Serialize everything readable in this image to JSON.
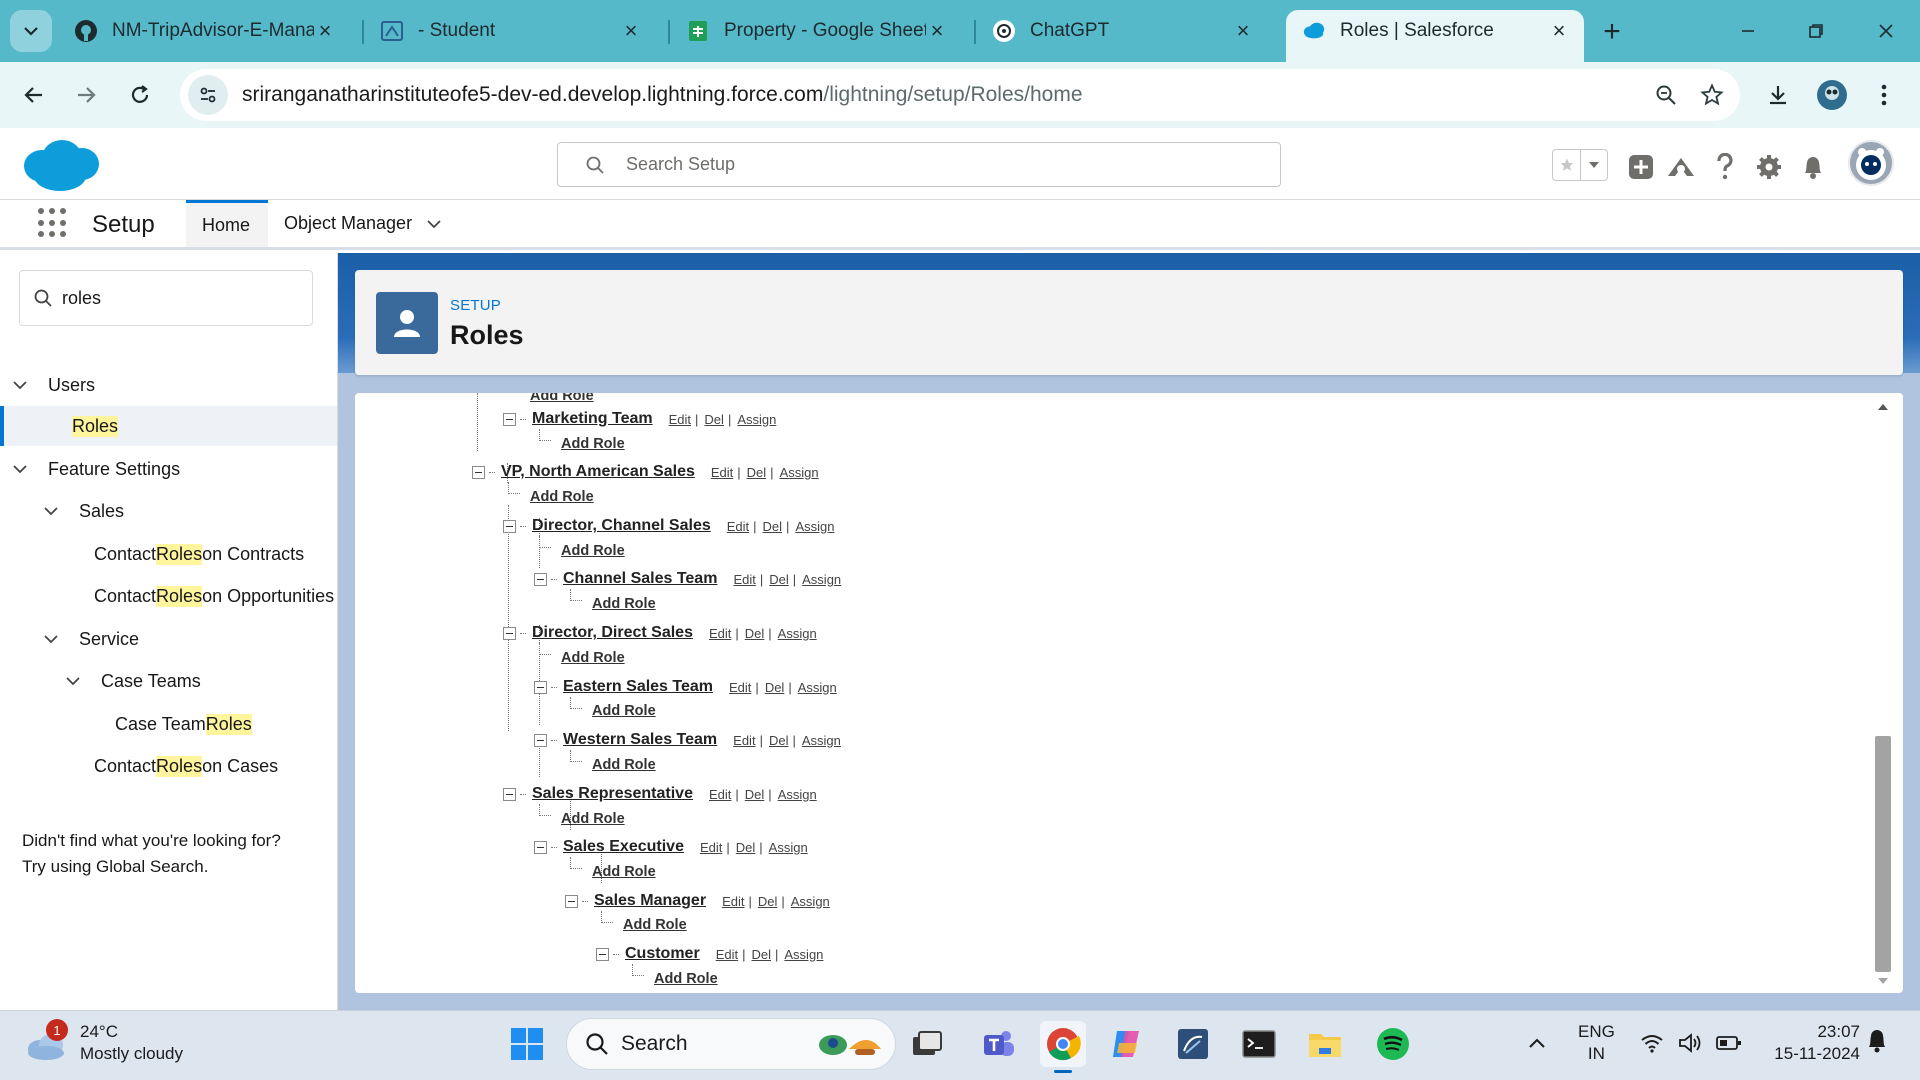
{
  "browser": {
    "tabs": [
      {
        "title": "NM-TripAdvisor-E-Manag",
        "icon": "github-icon"
      },
      {
        "title": "- Student",
        "icon": "student-icon"
      },
      {
        "title": "Property - Google Sheets",
        "icon": "google-sheets-icon"
      },
      {
        "title": "ChatGPT",
        "icon": "chatgpt-icon"
      },
      {
        "title": "Roles | Salesforce",
        "icon": "salesforce-icon",
        "active": true
      }
    ],
    "url_host": "sriranganatharinstituteofe5-dev-ed.develop.lightning.force.com",
    "url_path": "/lightning/setup/Roles/home"
  },
  "header": {
    "search_placeholder": "Search Setup"
  },
  "context_nav": {
    "app_name": "Setup",
    "tabs": [
      {
        "label": "Home",
        "active": true
      },
      {
        "label": "Object Manager"
      }
    ]
  },
  "sidebar": {
    "quick_find_value": "roles",
    "items": [
      {
        "pre": "Users",
        "hl": "",
        "post": ""
      },
      {
        "pre": "",
        "hl": "Roles",
        "post": ""
      },
      {
        "pre": "Feature Settings",
        "hl": "",
        "post": ""
      },
      {
        "pre": "Sales",
        "hl": "",
        "post": ""
      },
      {
        "pre": "Contact ",
        "hl": "Roles",
        "post": " on Contracts"
      },
      {
        "pre": "Contact ",
        "hl": "Roles",
        "post": " on Opportunities"
      },
      {
        "pre": "Service",
        "hl": "",
        "post": ""
      },
      {
        "pre": "Case Teams",
        "hl": "",
        "post": ""
      },
      {
        "pre": "Case Team ",
        "hl": "Roles",
        "post": ""
      },
      {
        "pre": "Contact ",
        "hl": "Roles",
        "post": " on Cases"
      }
    ],
    "not_found_line1": "Didn't find what you're looking for?",
    "not_found_line2": "Try using Global Search."
  },
  "page": {
    "eyebrow": "SETUP",
    "title": "Roles"
  },
  "actions": {
    "edit": "Edit",
    "del": "Del",
    "assign": "Assign",
    "add_role": "Add Role"
  },
  "roles": [
    {
      "name": "Marketing Team"
    },
    {
      "name": "VP, North American Sales"
    },
    {
      "name": "Director, Channel Sales"
    },
    {
      "name": "Channel Sales Team"
    },
    {
      "name": "Director, Direct Sales"
    },
    {
      "name": "Eastern Sales Team"
    },
    {
      "name": "Western Sales Team"
    },
    {
      "name": "Sales Representative"
    },
    {
      "name": "Sales Executive"
    },
    {
      "name": "Sales Manager"
    },
    {
      "name": "Customer"
    }
  ],
  "taskbar": {
    "weather_temp": "24°C",
    "weather_desc": "Mostly cloudy",
    "weather_badge": "1",
    "search_label": "Search",
    "lang_line1": "ENG",
    "lang_line2": "IN",
    "time": "23:07",
    "date": "15-11-2024"
  },
  "colors": {
    "browser_chrome": "#56b9c9",
    "salesforce_blue": "#0176d3",
    "highlight": "#fff59d"
  }
}
